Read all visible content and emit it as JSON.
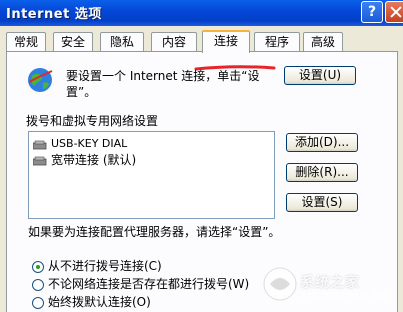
{
  "window": {
    "title": "Internet 选项"
  },
  "tabs": [
    {
      "label": "常规"
    },
    {
      "label": "安全"
    },
    {
      "label": "隐私"
    },
    {
      "label": "内容"
    },
    {
      "label": "连接",
      "active": true
    },
    {
      "label": "程序"
    },
    {
      "label": "高级"
    }
  ],
  "intro": {
    "text": "要设置一个 Internet 连接，单击“设置”。",
    "setup_button": "设置(U)"
  },
  "dialup": {
    "section_label": "拨号和虚拟专用网络设置",
    "connections": [
      {
        "label": "USB-KEY DIAL"
      },
      {
        "label": "宽带连接 (默认)"
      }
    ],
    "add_button": "添加(D)...",
    "remove_button": "删除(R)...",
    "settings_button": "设置(S)"
  },
  "proxy": {
    "text": "如果要为连接配置代理服务器，请选择“设置”。"
  },
  "radio_options": [
    {
      "label": "从不进行拨号连接(C)",
      "selected": true
    },
    {
      "label": "不论网络连接是否存在都进行拨号(W)",
      "selected": false
    },
    {
      "label": "始终拨默认连接(O)",
      "selected": false
    }
  ],
  "watermark": {
    "text": "系统之家",
    "sub": "XITONGZHIJIA.NET"
  },
  "colors": {
    "titlebar": "#0546d6",
    "active_tab_accent": "#f7b33a",
    "annotation": "#e8242b"
  }
}
